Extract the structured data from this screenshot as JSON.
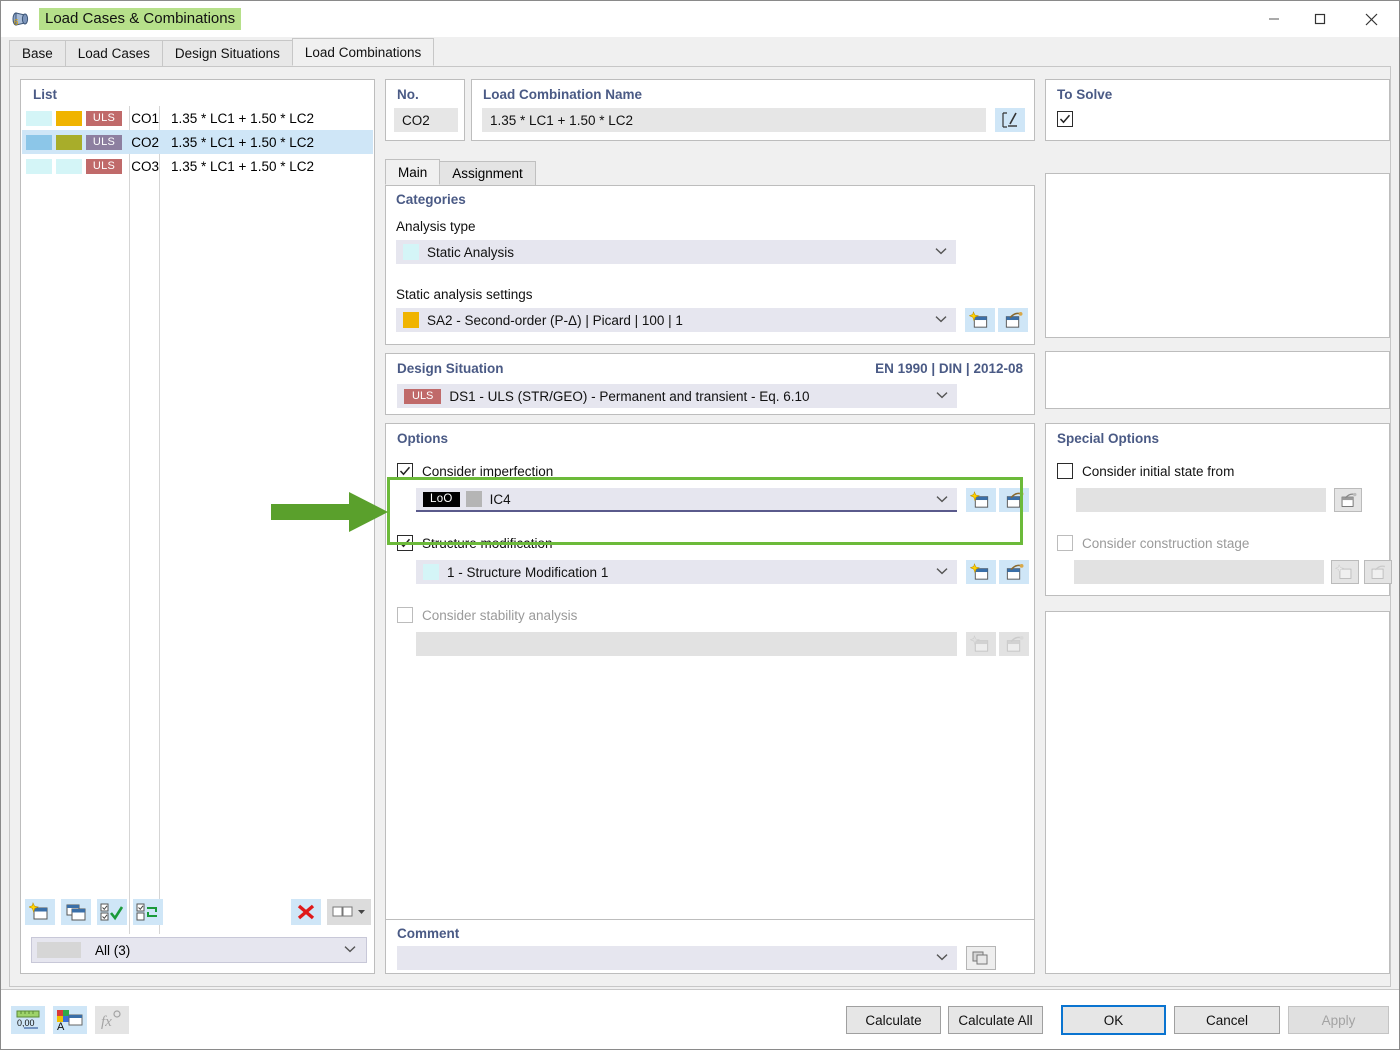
{
  "window": {
    "title": "Load Cases & Combinations",
    "icon": "load-cases-icon",
    "minimize": "—",
    "maximize": "☐",
    "close": "✕"
  },
  "main_tabs": [
    {
      "label": "Base",
      "active": false
    },
    {
      "label": "Load Cases",
      "active": false
    },
    {
      "label": "Design Situations",
      "active": false
    },
    {
      "label": "Load Combinations",
      "active": true
    }
  ],
  "list": {
    "title": "List",
    "rows": [
      {
        "sw1": "#d4f5f7",
        "sw2": "#f0b400",
        "badge": "ULS",
        "badge_color": "#c06a6a",
        "no": "CO1",
        "expr": "1.35 * LC1 + 1.50 * LC2",
        "selected": false
      },
      {
        "sw1": "#8cc6e8",
        "sw2": "#a8ad2a",
        "badge": "ULS",
        "badge_color": "#8d7fa0",
        "no": "CO2",
        "expr": "1.35 * LC1 + 1.50 * LC2",
        "selected": true
      },
      {
        "sw1": "#d4f5f7",
        "sw2": "#d4f5f7",
        "badge": "ULS",
        "badge_color": "#c06a6a",
        "no": "CO3",
        "expr": "1.35 * LC1 + 1.50 * LC2",
        "selected": false
      }
    ],
    "toolbar": [
      {
        "name": "new-item-button",
        "icon": "new-window-icon"
      },
      {
        "name": "copy-item-button",
        "icon": "copy-window-icon"
      },
      {
        "name": "select-all-button",
        "icon": "check-all-icon"
      },
      {
        "name": "invert-selection-button",
        "icon": "invert-selection-icon"
      },
      {
        "name": "delete-item-button",
        "icon": "red-x-icon"
      },
      {
        "name": "view-mode-button",
        "icon": "two-pane-icon"
      }
    ],
    "filter": {
      "label": "All (3)",
      "arrow": "⌄"
    }
  },
  "header": {
    "no_label": "No.",
    "no_value": "CO2",
    "name_label": "Load Combination Name",
    "name_value": "1.35 * LC1 + 1.50 * LC2",
    "edit_icon": "edit-formula-icon"
  },
  "inner_tabs": [
    {
      "label": "Main",
      "active": true
    },
    {
      "label": "Assignment",
      "active": false
    }
  ],
  "categories": {
    "title": "Categories",
    "analysis_type_label": "Analysis type",
    "analysis_type_value": "Static Analysis",
    "analysis_type_swatch": "#d4f5f7",
    "settings_label": "Static analysis settings",
    "settings_value": "SA2 - Second-order (P-Δ) | Picard | 100 | 1",
    "settings_swatch": "#f0b400",
    "new_icon": "new-window-icon",
    "edit_icon": "edit-window-icon",
    "arrow": "⌄"
  },
  "design_situation": {
    "title": "Design Situation",
    "standard": "EN 1990 | DIN | 2012-08",
    "badge": "ULS",
    "value": "DS1 - ULS (STR/GEO) - Permanent and transient - Eq. 6.10",
    "arrow": "⌄"
  },
  "options": {
    "title": "Options",
    "imperfection": {
      "label": "Consider imperfection",
      "checked": true,
      "enabled": true,
      "badge": "LoO",
      "swatch": "#b5b5b5",
      "value": "IC4",
      "arrow": "⌄",
      "new_icon": "new-window-icon",
      "edit_icon": "edit-window-icon",
      "highlighted": true
    },
    "structure_modification": {
      "label": "Structure modification",
      "checked": true,
      "enabled": true,
      "swatch": "#d4f5f7",
      "value": "1 - Structure Modification 1",
      "arrow": "⌄",
      "new_icon": "new-window-icon",
      "edit_icon": "edit-window-icon"
    },
    "stability": {
      "label": "Consider stability analysis",
      "checked": false,
      "enabled": false,
      "value": "",
      "new_icon": "new-window-icon",
      "edit_icon": "edit-window-icon"
    }
  },
  "comment": {
    "title": "Comment",
    "value": "",
    "arrow": "⌄",
    "icon": "comment-library-icon"
  },
  "to_solve": {
    "title": "To Solve",
    "checked": true
  },
  "special_options": {
    "title": "Special Options",
    "initial_state": {
      "label": "Consider initial state from",
      "checked": false,
      "enabled": true,
      "value": "",
      "edit_icon": "edit-window-icon"
    },
    "construction_stage": {
      "label": "Consider construction stage",
      "checked": false,
      "enabled": false,
      "value": "",
      "new_icon": "new-window-icon",
      "edit_icon": "edit-window-icon"
    }
  },
  "bottom": {
    "left_icons": [
      {
        "name": "units-button",
        "icon": "units-000-icon",
        "enabled": true,
        "text": "0,00"
      },
      {
        "name": "display-properties-button",
        "icon": "color-palette-icon",
        "enabled": true
      },
      {
        "name": "formula-button",
        "icon": "fx-icon",
        "enabled": false
      }
    ],
    "buttons": [
      {
        "label": "Calculate",
        "name": "calculate-button",
        "style": "normal"
      },
      {
        "label": "Calculate All",
        "name": "calculate-all-button",
        "style": "normal"
      },
      {
        "label": "OK",
        "name": "ok-button",
        "style": "primary"
      },
      {
        "label": "Cancel",
        "name": "cancel-button",
        "style": "normal"
      },
      {
        "label": "Apply",
        "name": "apply-button",
        "style": "disabled"
      }
    ]
  },
  "annotation": {
    "arrow_color": "#5aa02c",
    "highlight_color": "#6cba3a"
  }
}
